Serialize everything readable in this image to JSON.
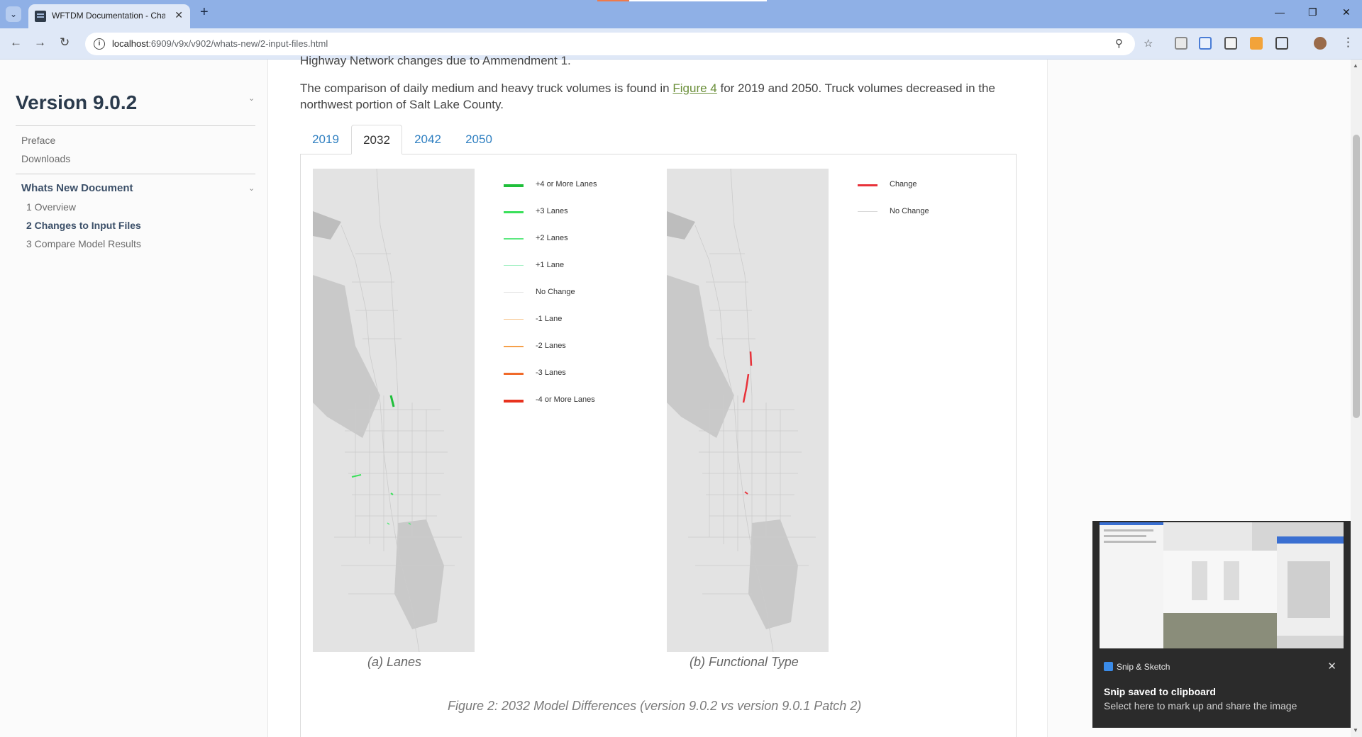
{
  "browser": {
    "tab_title": "WFTDM Documentation - Changes to Input Files",
    "url_host": "localhost",
    "url_rest": ":6909/v9x/v902/whats-new/2-input-files.html"
  },
  "sidebar": {
    "version_title": "Version 9.0.2",
    "top_links": [
      "Preface",
      "Downloads"
    ],
    "section_title": "Whats New Document",
    "section_items": [
      "1 Overview",
      "2 Changes to Input Files",
      "3 Compare Model Results"
    ],
    "active_index": 1
  },
  "content": {
    "cut_line": "Highway Network changes due to Ammendment 1.",
    "para_before": "The comparison of daily medium and heavy truck volumes is found in ",
    "para_link": "Figure 4",
    "para_after": " for 2019 and 2050. Truck volumes decreased in the northwest portion of Salt Lake County.",
    "year_tabs": [
      "2019",
      "2032",
      "2042",
      "2050"
    ],
    "active_tab": 1,
    "legend_lanes": [
      {
        "label": "+4 or More Lanes",
        "color": "#1fbf3a"
      },
      {
        "label": "+3 Lanes",
        "color": "#3ae05a"
      },
      {
        "label": "+2 Lanes",
        "color": "#5de880"
      },
      {
        "label": "+1 Lane",
        "color": "#9ef0c0"
      },
      {
        "label": "No Change",
        "color": "#e6e6e6"
      },
      {
        "label": "-1 Lane",
        "color": "#f7c48a"
      },
      {
        "label": "-2 Lanes",
        "color": "#f5a04a"
      },
      {
        "label": "-3 Lanes",
        "color": "#f06a2a"
      },
      {
        "label": "-4 or More Lanes",
        "color": "#e8321e"
      }
    ],
    "legend_functional": [
      {
        "label": "Change",
        "color": "#e8323a"
      },
      {
        "label": "No Change",
        "color": "#d8d8d8"
      }
    ],
    "caption_a": "(a) Lanes",
    "caption_b": "(b) Functional Type",
    "figure_caption": "Figure 2: 2032 Model Differences (version 9.0.2 vs version 9.0.1 Patch 2)"
  },
  "notification": {
    "app_name": "Snip & Sketch",
    "title": "Snip saved to clipboard",
    "subtitle": "Select here to mark up and share the image"
  }
}
